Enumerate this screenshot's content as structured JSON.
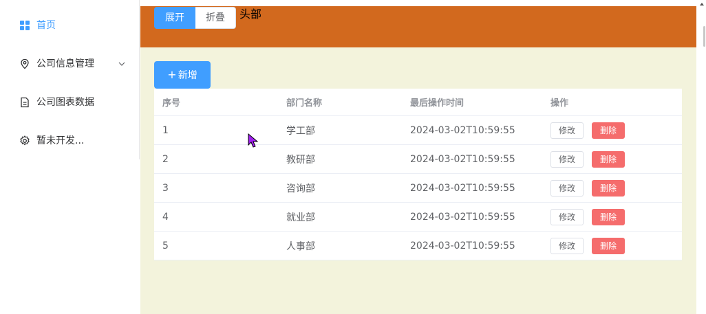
{
  "sidebar": {
    "items": [
      {
        "label": "首页",
        "icon": "grid-icon",
        "active": true
      },
      {
        "label": "公司信息管理",
        "icon": "location-pin-icon",
        "has_submenu": true
      },
      {
        "label": "公司图表数据",
        "icon": "document-icon"
      },
      {
        "label": "暂未开发...",
        "icon": "gear-icon"
      }
    ]
  },
  "header": {
    "expand_label": "展开",
    "collapse_label": "折叠",
    "title": "头部",
    "background": "#d2691e"
  },
  "toolbar": {
    "add_label": "新增",
    "add_icon": "plus-icon"
  },
  "table": {
    "columns": [
      "序号",
      "部门名称",
      "最后操作时间",
      "操作"
    ],
    "rows": [
      {
        "id": "1",
        "name": "学工部",
        "time": "2024-03-02T10:59:55"
      },
      {
        "id": "2",
        "name": "教研部",
        "time": "2024-03-02T10:59:55"
      },
      {
        "id": "3",
        "name": "咨询部",
        "time": "2024-03-02T10:59:55"
      },
      {
        "id": "4",
        "name": "就业部",
        "time": "2024-03-02T10:59:55"
      },
      {
        "id": "5",
        "name": "人事部",
        "time": "2024-03-02T10:59:55"
      }
    ],
    "edit_label": "修改",
    "delete_label": "删除"
  },
  "colors": {
    "primary": "#409eff",
    "danger": "#f56c6c",
    "main_bg": "#f3f3dc"
  }
}
